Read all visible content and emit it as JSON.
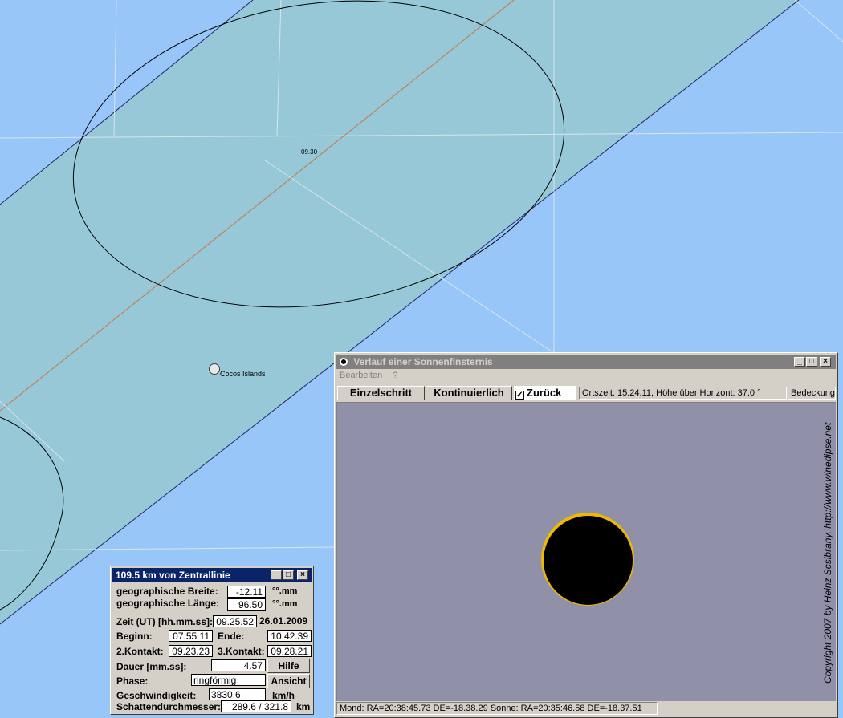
{
  "map": {
    "time_label": "09.30",
    "place_label": "Cocos Islands"
  },
  "colors": {
    "ocean": "#99c6f8",
    "eclipse_band": "#96c8d8",
    "central_line": "#c8783c",
    "sun_ring": "#f0b800",
    "sky": "#9090a8",
    "titlebar_active": "#0a246a",
    "titlebar_inactive": "#808080"
  },
  "eclipse_window": {
    "title": "Verlauf einer Sonnenfinsternis",
    "menu": [
      "Bearbeiten",
      "?"
    ],
    "buttons": {
      "single_step": "Einzelschritt",
      "continuous": "Kontinuierlich"
    },
    "back_checkbox": {
      "label": "Zurück",
      "checked": true
    },
    "local_time_status": "Ortszeit: 15.24.11, Höhe über Horizont:  37.0 °",
    "coverage_label": "Bedeckung:",
    "copyright": "Copyright 2007 by Heinz Scsibrany,  http://www.winedipse.net",
    "bottom_status": "Mond: RA=20:38:45.73 DE=-18.38.29  Sonne: RA=20:35:46.58 DE=-18.37.51"
  },
  "info_window": {
    "title": "109.5 km von Zentrallinie",
    "lat_label": "geographische Breite:",
    "lat_value": "-12.11",
    "lat_unit": "°°.mm",
    "lon_label": "geographische Länge:",
    "lon_value": "96.50",
    "lon_unit": "°°.mm",
    "time_label": "Zeit (UT) [hh.mm.ss]:",
    "time_value": "09.25.52",
    "date": "26.01.2009",
    "begin_label": "Beginn:",
    "begin_value": "07.55.11",
    "end_label": "Ende:",
    "end_value": "10.42.39",
    "contact2_label": "2.Kontakt:",
    "contact2_value": "09.23.23",
    "contact3_label": "3.Kontakt:",
    "contact3_value": "09.28.21",
    "duration_label": "Dauer [mm.ss]:",
    "duration_value": "4.57",
    "help_button": "Hilfe",
    "phase_label": "Phase:",
    "phase_value": "ringförmig",
    "view_button": "Ansicht",
    "speed_label": "Geschwindigkeit:",
    "speed_value": "3830.6",
    "speed_unit": "km/h",
    "shadow_label": "Schattendurchmesser:",
    "shadow_value": "289.6 / 321.8",
    "shadow_unit": "km"
  }
}
